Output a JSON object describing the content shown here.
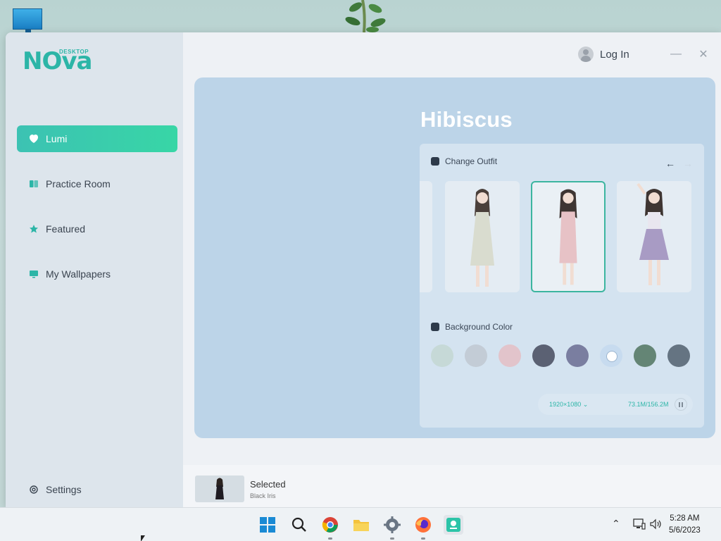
{
  "app": {
    "logo_text": "NOva",
    "logo_sub": "DESKTOP"
  },
  "sidebar": {
    "items": [
      {
        "label": "Lumi",
        "icon": "lumi-icon",
        "active": true
      },
      {
        "label": "Practice Room",
        "icon": "book-icon",
        "active": false
      },
      {
        "label": "Featured",
        "icon": "star-icon",
        "active": false
      },
      {
        "label": "My Wallpapers",
        "icon": "monitor-icon",
        "active": false
      }
    ],
    "settings_label": "Settings"
  },
  "header": {
    "login_label": "Log In",
    "minimize": "—",
    "close": "✕"
  },
  "main": {
    "title": "Hibiscus",
    "outfit_section": "Change Outfit",
    "outfits": [
      {
        "dress_color": "#d9dccf",
        "selected": false
      },
      {
        "dress_color": "#e7c2c6",
        "selected": true
      },
      {
        "dress_color": "#a89bc4",
        "selected": false
      }
    ],
    "background_section": "Background Color",
    "background_colors": [
      {
        "color": "#c6d9d7",
        "selected": false
      },
      {
        "color": "#c3ccd6",
        "selected": false
      },
      {
        "color": "#e2c4cb",
        "selected": false
      },
      {
        "color": "#5b6173",
        "selected": false
      },
      {
        "color": "#7a7ea0",
        "selected": false
      },
      {
        "color": "#c7dbef",
        "selected": true
      },
      {
        "color": "#648575",
        "selected": false
      },
      {
        "color": "#657482",
        "selected": false
      }
    ],
    "resolution": "1920×1080 ⌄",
    "download_size": "73.1M/156.2M"
  },
  "selected_bar": {
    "title": "Selected",
    "subtitle": "Black Iris"
  },
  "taskbar": {
    "apps": [
      "windows-start-icon",
      "search-icon",
      "chrome-icon",
      "file-explorer-icon",
      "settings-gear-icon",
      "firefox-icon",
      "nova-desktop-icon"
    ],
    "time": "5:28 AM",
    "date": "5/6/2023"
  },
  "colors": {
    "accent": "#3cc2b3",
    "panel": "#bcd4e8"
  }
}
